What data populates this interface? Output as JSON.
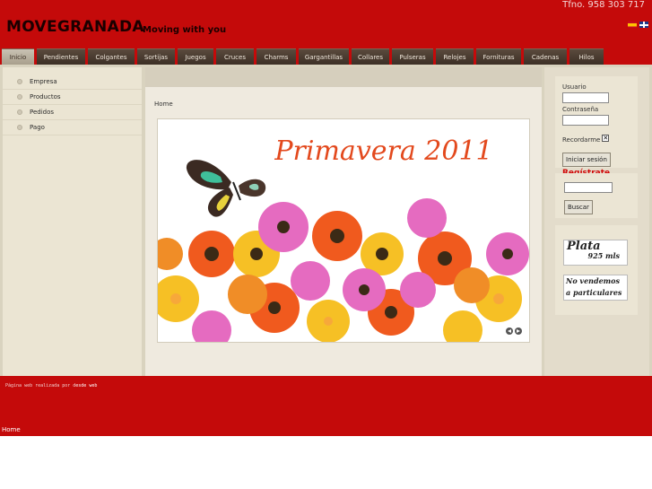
{
  "header": {
    "phone": "Tfno. 958 303 717",
    "brand": "MOVEGRANADA",
    "tagline": "Moving with you",
    "languages": [
      "es-flag-icon",
      "en-flag-icon"
    ]
  },
  "nav": {
    "tabs": [
      {
        "label": "Inicio",
        "active": true
      },
      {
        "label": "Pendientes"
      },
      {
        "label": "Colgantes"
      },
      {
        "label": "Sortijas"
      },
      {
        "label": "Juegos"
      },
      {
        "label": "Cruces"
      },
      {
        "label": "Charms"
      },
      {
        "label": "Gargantillas"
      },
      {
        "label": "Collares"
      },
      {
        "label": "Pulseras"
      },
      {
        "label": "Relojes"
      },
      {
        "label": "Fornituras"
      },
      {
        "label": "Cadenas"
      },
      {
        "label": "Hilos"
      }
    ]
  },
  "sidebar": {
    "items": [
      {
        "label": "Empresa"
      },
      {
        "label": "Productos"
      },
      {
        "label": "Pedidos"
      },
      {
        "label": "Pago"
      }
    ]
  },
  "content": {
    "breadcrumb": "Home",
    "banner_title": "Primavera 2011"
  },
  "login": {
    "user_label": "Usuario",
    "user_value": "",
    "password_label": "Contraseña",
    "password_value": "",
    "remember_label": "Recordarme",
    "remember_checked": true,
    "submit_label": "Iniciar sesión",
    "register_label": "Regístrate"
  },
  "search": {
    "value": "",
    "button_label": "Buscar"
  },
  "promos": {
    "plata_line1": "Plata",
    "plata_line2": "925 mls",
    "noventa_line1": "No vendemos",
    "noventa_line2": "a particulares"
  },
  "footer": {
    "credit_prefix": "Página web realizada por d",
    "credit_link": "esde web",
    "home": "Home"
  },
  "colors": {
    "brand_red": "#c40a0a",
    "tab_dark": "#3c2f25",
    "register_red": "#d10808"
  }
}
